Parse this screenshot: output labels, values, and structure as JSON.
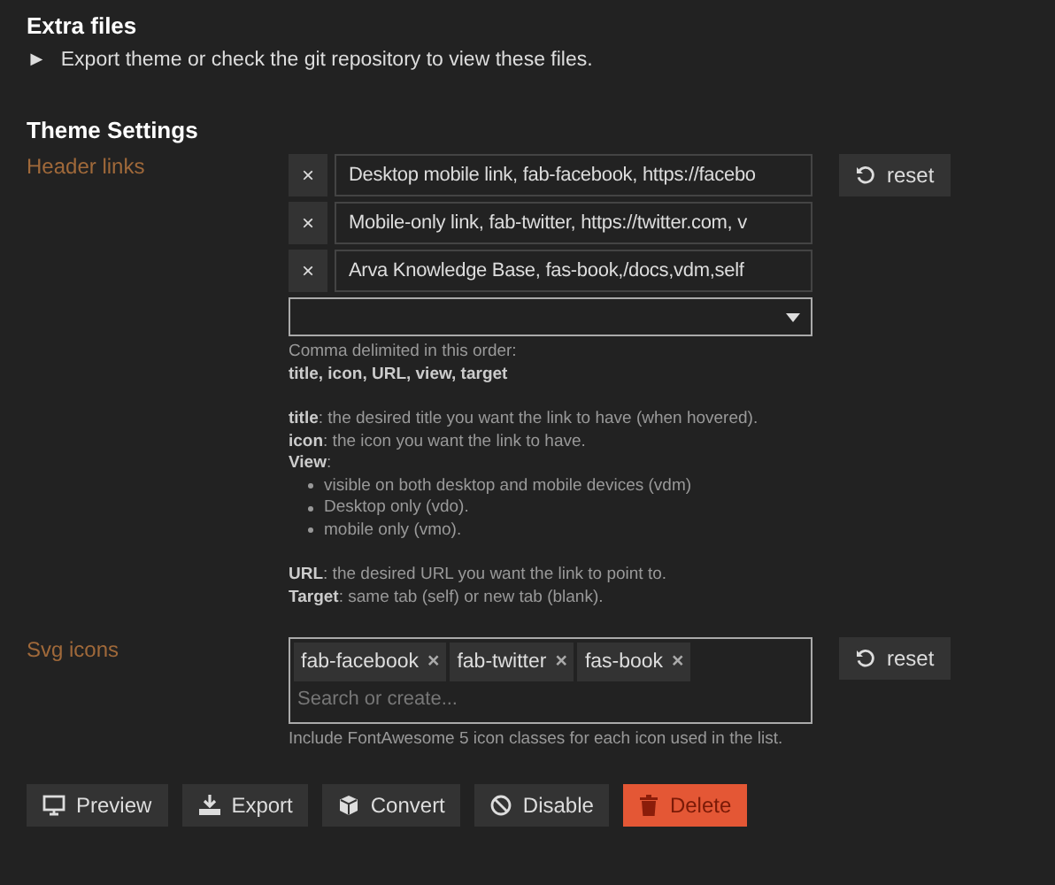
{
  "extra_files": {
    "title": "Extra files",
    "toggle": "►",
    "text": "Export theme or check the git repository to view these files."
  },
  "theme_settings": {
    "title": "Theme Settings",
    "header_links": {
      "label": "Header links",
      "remove": "×",
      "reset": "reset",
      "items": [
        "Desktop mobile link, fab-facebook, https://facebo",
        "Mobile-only link, fab-twitter, https://twitter.com, v",
        "Arva Knowledge Base, fas-book,/docs,vdm,self"
      ],
      "help": [
        {
          "kind": "line",
          "text": "Comma delimited in this order:"
        },
        {
          "kind": "strong",
          "text": "title, icon, URL, view, target"
        },
        {
          "kind": "para",
          "text": "**title**: the desired title you want the link to have (when hovered)."
        },
        {
          "kind": "line",
          "text": "**icon**: the icon you want the link to have."
        },
        {
          "kind": "line",
          "text": "**View**:"
        },
        {
          "kind": "bullet",
          "text": "visible on both desktop and mobile devices (vdm)"
        },
        {
          "kind": "bullet",
          "text": "Desktop only (vdo)."
        },
        {
          "kind": "bullet",
          "text": "mobile only (vmo)."
        },
        {
          "kind": "para",
          "text": "**URL**: the desired URL you want the link to point to."
        },
        {
          "kind": "line",
          "text": "**Target**: same tab (self) or new tab (blank)."
        }
      ]
    },
    "svg_icons": {
      "label": "Svg icons",
      "tags": [
        "fab-facebook",
        "fab-twitter",
        "fas-book"
      ],
      "remove": "×",
      "placeholder": "Search or create...",
      "help": "Include FontAwesome 5 icon classes for each icon used in the list.",
      "reset": "reset"
    }
  },
  "buttons": [
    {
      "label": "Preview",
      "kind": "normal"
    },
    {
      "label": "Export",
      "kind": "normal"
    },
    {
      "label": "Convert",
      "kind": "normal"
    },
    {
      "label": "Disable",
      "kind": "normal"
    },
    {
      "label": "Delete",
      "kind": "danger"
    }
  ]
}
